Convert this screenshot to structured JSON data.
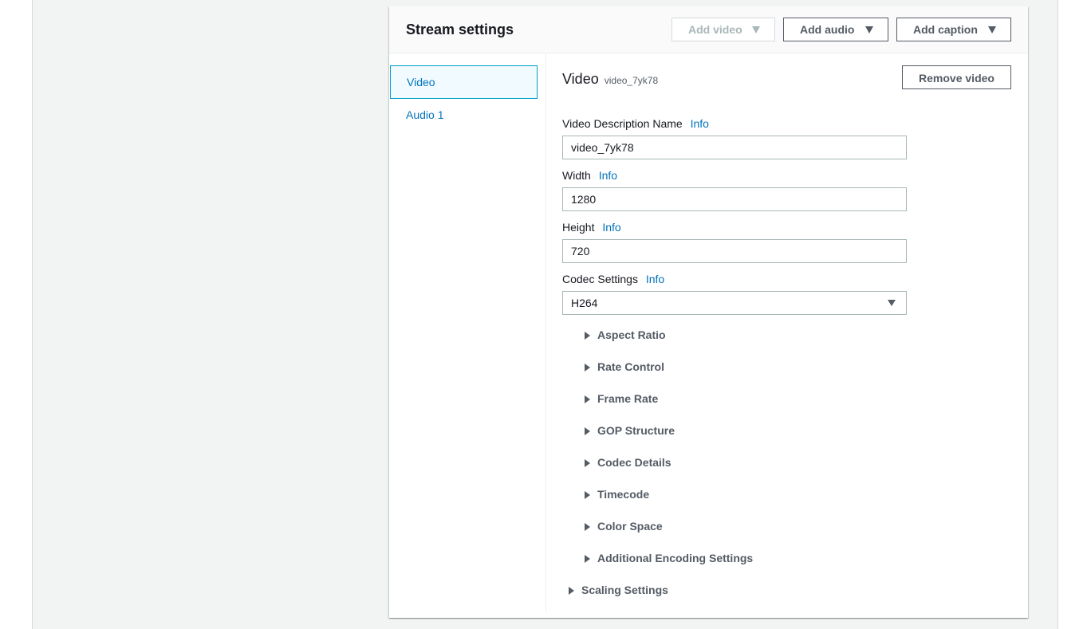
{
  "panel": {
    "title": "Stream settings",
    "buttons": {
      "add_video": "Add video",
      "add_audio": "Add audio",
      "add_caption": "Add caption"
    }
  },
  "nav": {
    "items": [
      {
        "label": "Video",
        "selected": true
      },
      {
        "label": "Audio 1",
        "selected": false
      }
    ]
  },
  "video": {
    "heading": "Video",
    "heading_sub": "video_7yk78",
    "remove_label": "Remove video",
    "info_label": "Info",
    "fields": {
      "description_name": {
        "label": "Video Description Name",
        "value": "video_7yk78"
      },
      "width": {
        "label": "Width",
        "value": "1280"
      },
      "height": {
        "label": "Height",
        "value": "720"
      },
      "codec": {
        "label": "Codec Settings",
        "value": "H264"
      }
    },
    "codec_sections": [
      "Aspect Ratio",
      "Rate Control",
      "Frame Rate",
      "GOP Structure",
      "Codec Details",
      "Timecode",
      "Color Space",
      "Additional Encoding Settings"
    ],
    "scaling_label": "Scaling Settings"
  },
  "colors": {
    "link": "#0073bb",
    "selected_border": "#00a1c9",
    "text": "#16191f",
    "muted": "#545b64",
    "disabled": "#aab7b8"
  }
}
